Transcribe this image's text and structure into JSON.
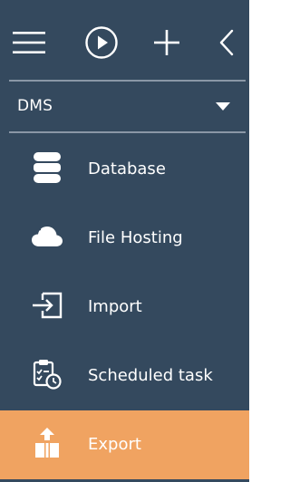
{
  "colors": {
    "panel_background": "#34495e",
    "active_background": "#f0a361",
    "divider": "#8a97a6",
    "text": "#ffffff"
  },
  "toolbar": {
    "icons": [
      "hamburger-menu-icon",
      "play-circle-icon",
      "plus-icon",
      "chevron-left-icon"
    ]
  },
  "workspace_selector": {
    "selected": "DMS",
    "icon": "caret-down-icon"
  },
  "menu": {
    "items": [
      {
        "label": "Database",
        "icon": "database-icon",
        "active": false
      },
      {
        "label": "File Hosting",
        "icon": "cloud-icon",
        "active": false
      },
      {
        "label": "Import",
        "icon": "import-icon",
        "active": false
      },
      {
        "label": "Scheduled task",
        "icon": "scheduled-task-icon",
        "active": false
      },
      {
        "label": "Export",
        "icon": "export-icon",
        "active": true
      }
    ]
  }
}
